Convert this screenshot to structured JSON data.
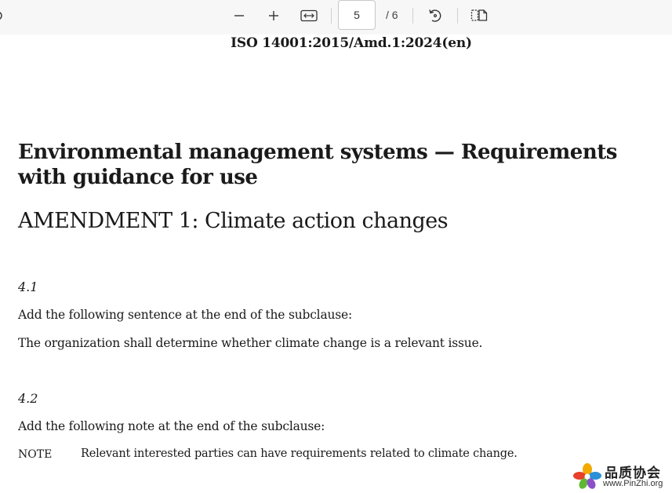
{
  "toolbar": {
    "page_current": "5",
    "page_total": "/ 6",
    "icons": [
      "partial-left-icon",
      "zoom-out-icon",
      "zoom-in-icon",
      "fit-width-icon",
      "rotate-icon",
      "two-page-view-icon"
    ]
  },
  "document": {
    "header": "ISO 14001:2015/Amd.1:2024(en)",
    "title": "Environmental management systems — Requirements with guidance for use",
    "subtitle": "AMENDMENT 1: Climate action changes",
    "clauses": [
      {
        "number": "4.1",
        "instruction": "Add the following sentence at the end of the subclause:",
        "content": "The organization shall determine whether climate change is a relevant issue."
      },
      {
        "number": "4.2",
        "instruction": "Add the following note at the end of the subclause:",
        "note_label": "NOTE",
        "note_text": "Relevant interested parties can have requirements related to climate change."
      }
    ]
  },
  "watermark": {
    "name_cn": "品质协会",
    "url": "www.PinZhi.org"
  }
}
